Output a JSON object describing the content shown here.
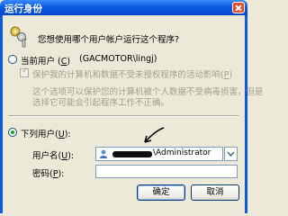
{
  "window": {
    "title": "运行身份"
  },
  "question": "您想使用哪个用户帐户运行这个程序?",
  "current_user": {
    "label": "当前用户 (",
    "label_key": "C",
    "label_suffix": ")",
    "account": "(GACMOTOR\\lingj)"
  },
  "protect": {
    "label": "保护我的计算机和数据不受未授权程序的活动影响(",
    "key": "P",
    "suffix": ")",
    "description_line1": "这个选项可以保护您的计算机被个人数据不受病毒损害，但是",
    "description_line2": "选择它可能会引起程序工作不正确。"
  },
  "following_user": {
    "label": "下列用户(",
    "key": "U",
    "suffix": "):"
  },
  "username": {
    "label": "用户名(",
    "key": "U",
    "suffix": "):",
    "value": "\\Administrator"
  },
  "password": {
    "label": "密码(",
    "key": "P",
    "suffix": "):",
    "value": ""
  },
  "buttons": {
    "ok": "确定",
    "cancel": "取消"
  }
}
